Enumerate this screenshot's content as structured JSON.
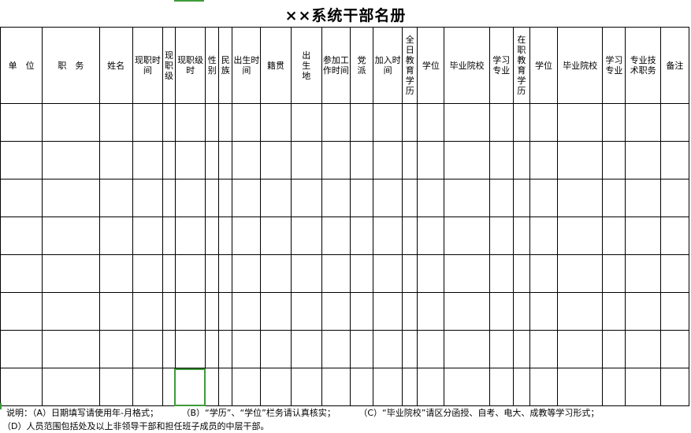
{
  "title": "××系统干部名册",
  "colors": {
    "selection": "#3f9b3a",
    "grid": "#000000",
    "accent": "#3f9b3a"
  },
  "columns": [
    {
      "id": "unit",
      "label": "单　位",
      "vertical": false
    },
    {
      "id": "duty",
      "label": "职　务",
      "vertical": false
    },
    {
      "id": "name",
      "label": "姓名",
      "vertical": false
    },
    {
      "id": "current_post_time",
      "label": "现职时间",
      "vertical": false
    },
    {
      "id": "current_level",
      "label": "现职级",
      "vertical": true
    },
    {
      "id": "current_level_time",
      "label": "现职级时",
      "vertical": false
    },
    {
      "id": "gender",
      "label": "性别",
      "vertical": true
    },
    {
      "id": "ethnicity",
      "label": "民族",
      "vertical": true
    },
    {
      "id": "birth_date",
      "label": "出生时间",
      "vertical": false
    },
    {
      "id": "native_place",
      "label": "籍贯",
      "vertical": false
    },
    {
      "id": "birthplace",
      "label": "出生地",
      "vertical": true
    },
    {
      "id": "work_start",
      "label": "参加工作时间",
      "vertical": false
    },
    {
      "id": "party",
      "label": "党派",
      "vertical": true
    },
    {
      "id": "join_time",
      "label": "加入时间",
      "vertical": false
    },
    {
      "id": "ft_edu",
      "label": "全日教育学历",
      "vertical": true
    },
    {
      "id": "ft_degree",
      "label": "学位",
      "vertical": false
    },
    {
      "id": "ft_school",
      "label": "毕业院校",
      "vertical": false
    },
    {
      "id": "ft_major",
      "label": "学习专业",
      "vertical": false
    },
    {
      "id": "ip_edu",
      "label": "在职教育学历",
      "vertical": true
    },
    {
      "id": "ip_degree",
      "label": "学位",
      "vertical": false
    },
    {
      "id": "ip_school",
      "label": "毕业院校",
      "vertical": false
    },
    {
      "id": "ip_major",
      "label": "学习专业",
      "vertical": false
    },
    {
      "id": "tech_title",
      "label": "专业技术职务",
      "vertical": false
    },
    {
      "id": "remarks",
      "label": "备注",
      "vertical": false
    }
  ],
  "row_count": 8,
  "notes": {
    "line1": [
      "说明：（A）日期填写请使用年-月格式；",
      "（B）“学历”、“学位”栏务请认真核实；",
      "（C）“毕业院校”请区分函授、自考、电大、成教等学习形式；"
    ],
    "line2": "（D）人员范围包括处及以上非领导干部和担任班子成员的中层干部。"
  }
}
